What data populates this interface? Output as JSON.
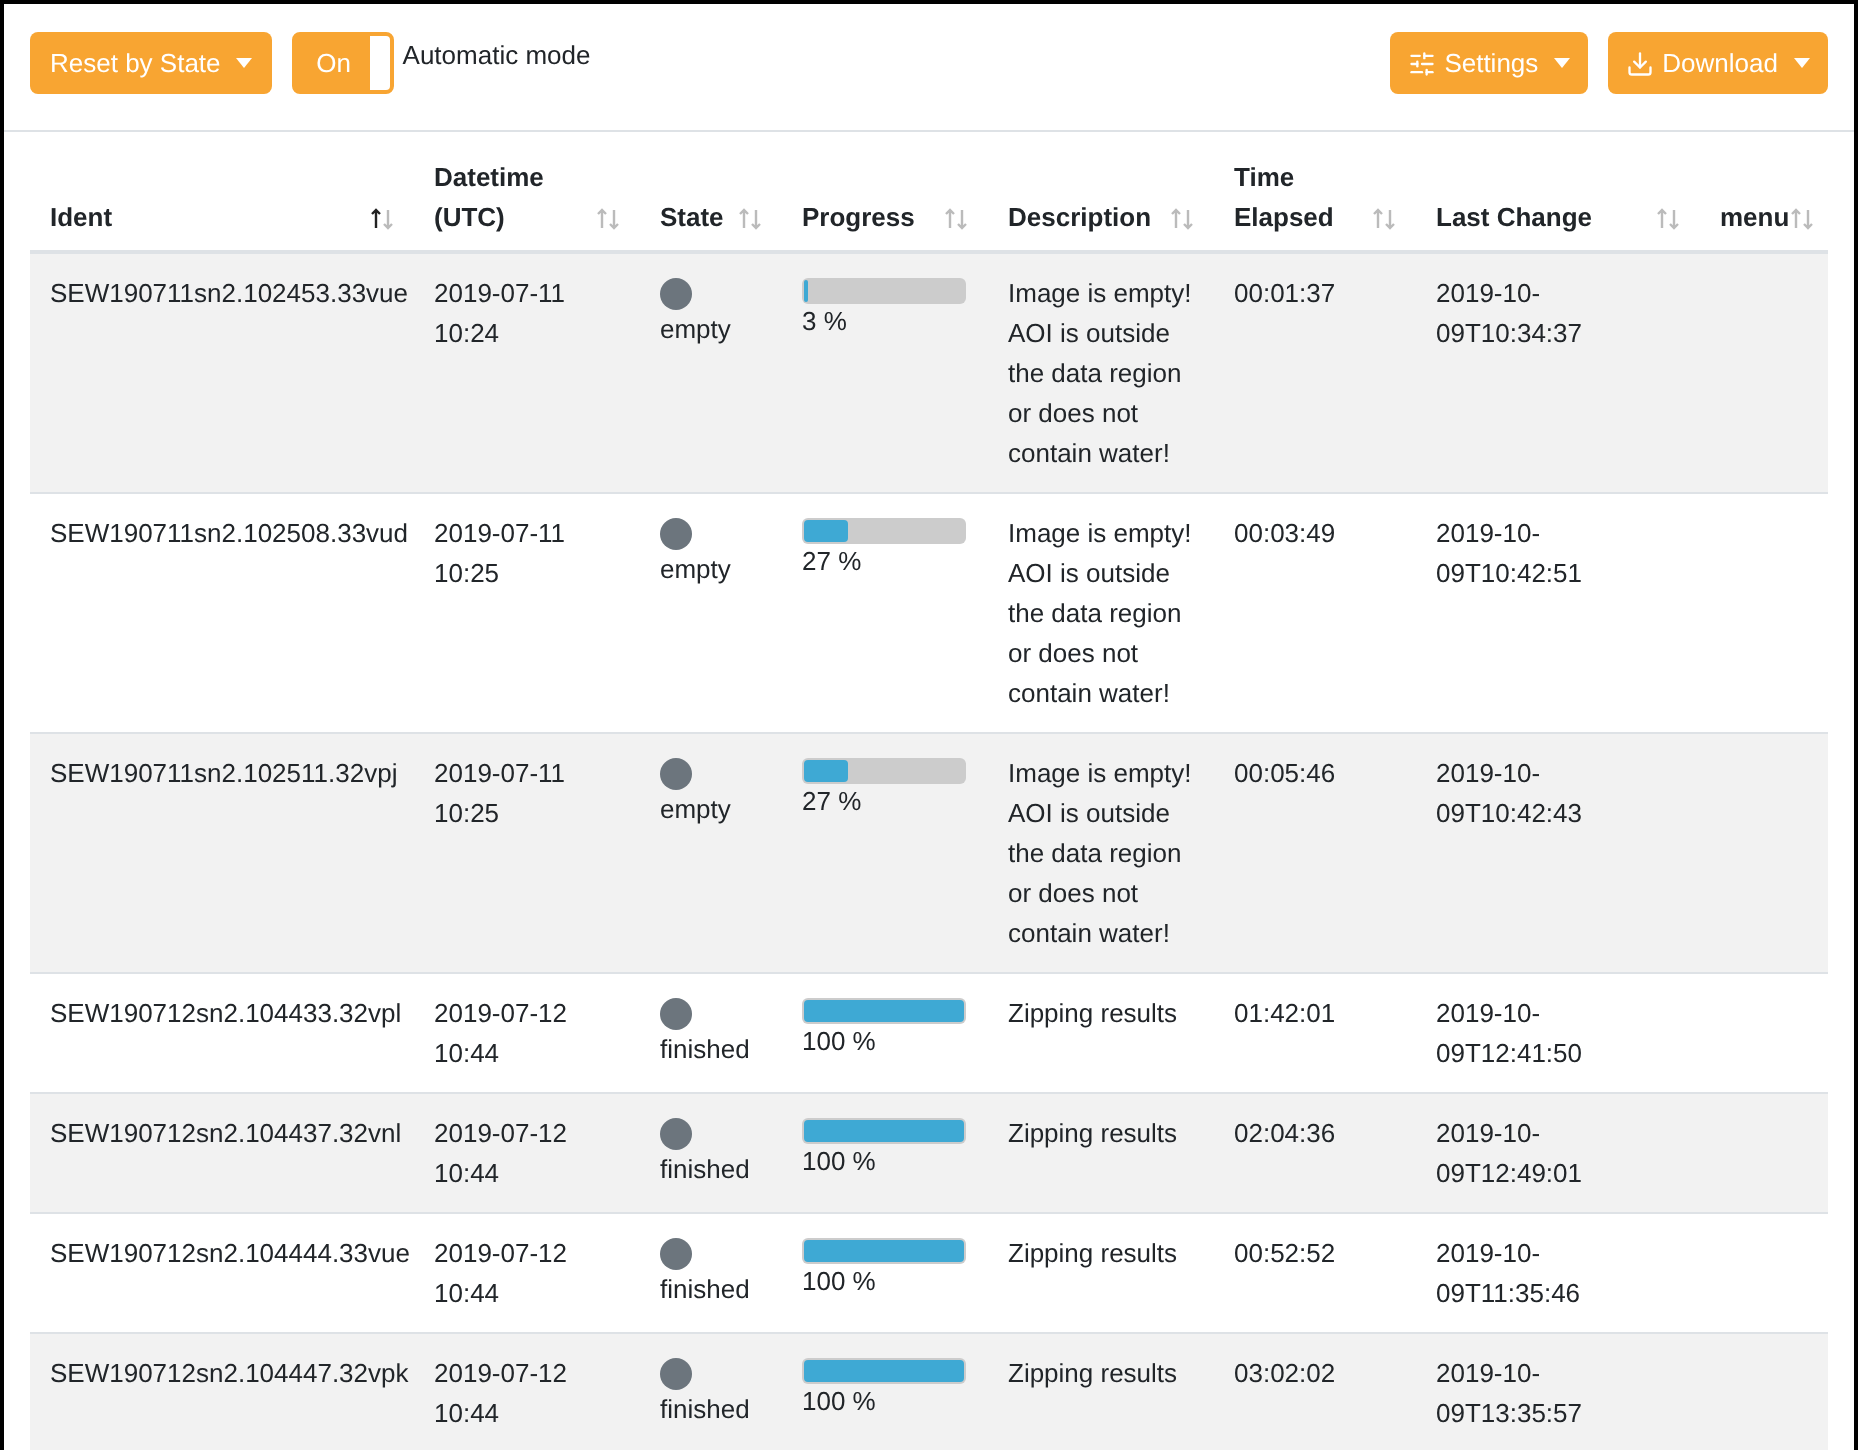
{
  "toolbar": {
    "reset_button": "Reset by State",
    "toggle": {
      "label": "On",
      "on": true
    },
    "toggle_caption": "Automatic mode",
    "settings_button": "Settings",
    "download_button": "Download"
  },
  "table": {
    "columns": [
      {
        "label": "Ident",
        "sorted": true
      },
      {
        "label": "Datetime (UTC)",
        "sorted": false
      },
      {
        "label": "State",
        "sorted": false
      },
      {
        "label": "Progress",
        "sorted": false
      },
      {
        "label": "Description",
        "sorted": false
      },
      {
        "label": "Time Elapsed",
        "sorted": false
      },
      {
        "label": "Last Change",
        "sorted": false
      },
      {
        "label": "menu",
        "sorted": false
      }
    ],
    "rows": [
      {
        "ident": "SEW190711sn2.102453.33vue",
        "date": "2019-07-11",
        "time": "10:24",
        "state": "empty",
        "color": "#6c757d",
        "level": 0.03,
        "progress": "3 %",
        "description": "Image is empty! AOI is outside the data region or does not contain water!",
        "elapsed": "00:01:37",
        "last_change": "2019-10-09T10:34:37"
      },
      {
        "ident": "SEW190711sn2.102508.33vud",
        "date": "2019-07-11",
        "time": "10:25",
        "state": "empty",
        "color": "#6c757d",
        "level": 0.27,
        "progress": "27 %",
        "description": "Image is empty! AOI is outside the data region or does not contain water!",
        "elapsed": "00:03:49",
        "last_change": "2019-10-09T10:42:51"
      },
      {
        "ident": "SEW190711sn2.102511.32vpj",
        "date": "2019-07-11",
        "time": "10:25",
        "state": "empty",
        "color": "#6c757d",
        "level": 0.27,
        "progress": "27 %",
        "description": "Image is empty! AOI is outside the data region or does not contain water!",
        "elapsed": "00:05:46",
        "last_change": "2019-10-09T10:42:43"
      },
      {
        "ident": "SEW190712sn2.104433.32vpl",
        "date": "2019-07-12",
        "time": "10:44",
        "state": "finished",
        "color": "#6c757d",
        "level": 1,
        "progress": "100 %",
        "description": "Zipping results",
        "elapsed": "01:42:01",
        "last_change": "2019-10-09T12:41:50"
      },
      {
        "ident": "SEW190712sn2.104437.32vnl",
        "date": "2019-07-12",
        "time": "10:44",
        "state": "finished",
        "color": "#6c757d",
        "level": 1,
        "progress": "100 %",
        "description": "Zipping results",
        "elapsed": "02:04:36",
        "last_change": "2019-10-09T12:49:01"
      },
      {
        "ident": "SEW190712sn2.104444.33vue",
        "date": "2019-07-12",
        "time": "10:44",
        "state": "finished",
        "color": "#6c757d",
        "level": 1,
        "progress": "100 %",
        "description": "Zipping results",
        "elapsed": "00:52:52",
        "last_change": "2019-10-09T11:35:46"
      },
      {
        "ident": "SEW190712sn2.104447.32vpk",
        "date": "2019-07-12",
        "time": "10:44",
        "state": "finished",
        "color": "#6c757d",
        "level": 1,
        "progress": "100 %",
        "description": "Zipping results",
        "elapsed": "03:02:02",
        "last_change": "2019-10-09T13:35:57"
      }
    ]
  }
}
